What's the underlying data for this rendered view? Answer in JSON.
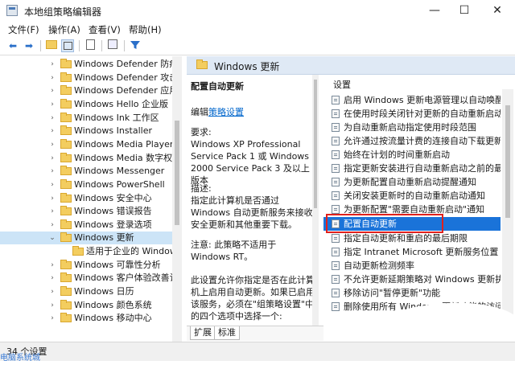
{
  "window": {
    "title": "本地组策略编辑器",
    "minimize": "—",
    "maximize": "☐",
    "close": "✕"
  },
  "menu": [
    "文件(F)",
    "操作(A)",
    "查看(V)",
    "帮助(H)"
  ],
  "toolbar": {
    "back_icon": "back-arrow-icon",
    "forward_icon": "forward-arrow-icon",
    "filter_icon": "filter-icon"
  },
  "tree": [
    {
      "label": "Windows Defender 防病毒",
      "selected": false
    },
    {
      "label": "Windows Defender 攻击防护",
      "selected": false
    },
    {
      "label": "Windows Defender 应用程序防护",
      "selected": false
    },
    {
      "label": "Windows Hello 企业版",
      "selected": false
    },
    {
      "label": "Windows Ink 工作区",
      "selected": false
    },
    {
      "label": "Windows Installer",
      "selected": false
    },
    {
      "label": "Windows Media Player",
      "selected": false
    },
    {
      "label": "Windows Media 数字权限管理",
      "selected": false
    },
    {
      "label": "Windows Messenger",
      "selected": false
    },
    {
      "label": "Windows PowerShell",
      "selected": false
    },
    {
      "label": "Windows 安全中心",
      "selected": false
    },
    {
      "label": "Windows 错误报告",
      "selected": false
    },
    {
      "label": "Windows 登录选项",
      "selected": false
    },
    {
      "label": "Windows 更新",
      "selected": true,
      "expanded": true
    },
    {
      "label": "适用于企业的 Windows 更新",
      "selected": false,
      "child": true
    },
    {
      "label": "Windows 可靠性分析",
      "selected": false
    },
    {
      "label": "Windows 客户体验改善计划",
      "selected": false
    },
    {
      "label": "Windows 日历",
      "selected": false
    },
    {
      "label": "Windows 颜色系统",
      "selected": false
    },
    {
      "label": "Windows 移动中心",
      "selected": false
    }
  ],
  "header": {
    "title": "Windows 更新"
  },
  "description": {
    "title": "配置自动更新",
    "edit_prefix": "编辑",
    "edit_link": "策略设置",
    "requirements_label": "要求:",
    "requirements": "Windows XP Professional Service Pack 1 或 Windows 2000 Service Pack 3 及以上版本",
    "desc_label": "描述:",
    "desc_text": "指定此计算机是否通过 Windows 自动更新服务来接收安全更新和其他重要下载。",
    "note": "注意: 此策略不适用于 Windows RT。",
    "more": "此设置允许你指定是否在此计算机上启用自动更新。如果已启用该服务，必须在\"组策略设置\"中的四个选项中选择一个:"
  },
  "list": {
    "column_header": "设置",
    "items": [
      "启用 Windows 更新电源管理以自动唤醒系统",
      "在使用时段关闭针对更新的自动重新启动",
      "为自动重新启动指定使用时段范围",
      "允许通过按流量计费的连接自动下载更新",
      "始终在计划的时间重新启动",
      "指定更新安装进行自动重新启动之前的最后期限",
      "为更新配置自动重新启动提醒通知",
      "关闭安装更新时的自动重新启动通知",
      "为更新配置\"需要自动重新启动\"通知",
      "配置自动更新",
      "指定自动更新和重启的最后期限",
      "指定 Intranet Microsoft 更新服务位置",
      "自动更新检测频率",
      "不允许更新延期策略对 Windows 更新执行扫描",
      "移除访问\"暂停更新\"功能",
      "删除使用所有 Windows 更新功能的访问权限"
    ],
    "selected_index": 9
  },
  "tabs": [
    "扩展",
    "标准"
  ],
  "status": {
    "text": "34 个设置"
  },
  "watermark": "电脑系统城"
}
